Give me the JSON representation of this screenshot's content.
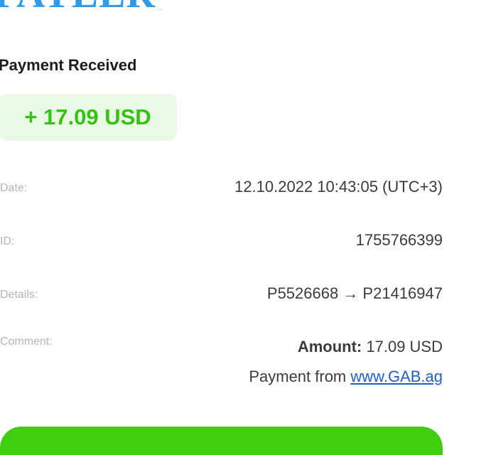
{
  "logo": {
    "text": "PAYEER",
    "registered": "®"
  },
  "receipt": {
    "title": "Payment Received",
    "amount": "+ 17.09 USD",
    "date_label": "Date:",
    "date_value": "12.10.2022 10:43:05 (UTC+3)",
    "id_label": "ID:",
    "id_value": "1755766399",
    "details_label": "Details:",
    "details_value": "P5526668 → P21416947",
    "comment_label": "Comment:",
    "comment_amount_label": "Amount:",
    "comment_amount_value": "17.09 USD",
    "comment_from_text": "Payment from",
    "comment_link": "www.GAB.ag"
  },
  "colors": {
    "accent_green": "#34c312",
    "badge_bg": "#eaf8e6",
    "logo_blue": "#2f9be8",
    "link_blue": "#1f5fc7"
  }
}
